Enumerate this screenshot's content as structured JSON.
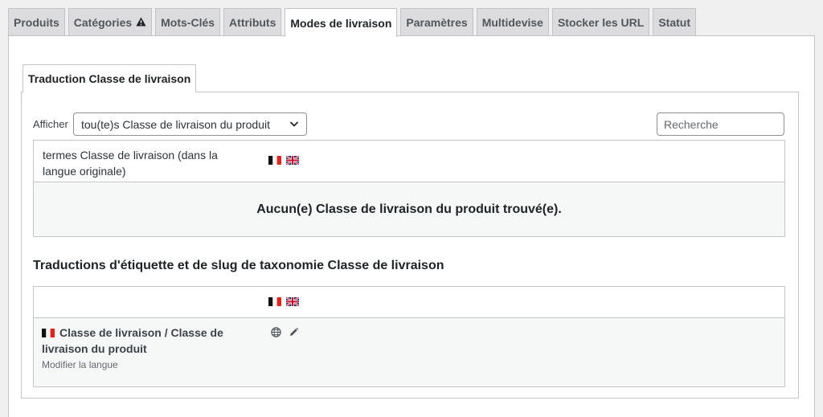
{
  "tabs": [
    {
      "label": "Produits",
      "active": false
    },
    {
      "label": "Catégories",
      "active": false,
      "warning": true
    },
    {
      "label": "Mots-Clés",
      "active": false
    },
    {
      "label": "Attributs",
      "active": false
    },
    {
      "label": "Modes de livraison",
      "active": true
    },
    {
      "label": "Paramètres",
      "active": false
    },
    {
      "label": "Multidevise",
      "active": false
    },
    {
      "label": "Stocker les URL",
      "active": false
    },
    {
      "label": "Statut",
      "active": false
    }
  ],
  "subtab": {
    "label": "Traduction Classe de livraison"
  },
  "filter": {
    "label": "Afficher",
    "selected": "tou(te)s Classe de livraison du produit",
    "search_placeholder": "Recherche"
  },
  "terms_table": {
    "column_header": "termes Classe de livraison (dans la langue originale)",
    "empty_message": "Aucun(e) Classe de livraison du produit trouvé(e)."
  },
  "section_title": "Traductions d'étiquette et de slug de taxonomie Classe de livraison",
  "taxonomy_table": {
    "row_title": "Classe de livraison / Classe de livraison du produit",
    "row_link": "Modifier la langue"
  },
  "icons": [
    "warning-icon",
    "chevron-down-icon",
    "flag-fr-icon",
    "flag-uk-icon",
    "globe-icon",
    "pencil-icon"
  ],
  "colors": {
    "active_tab": "#ffffff",
    "inactive_tab": "#dcdcde",
    "border": "#c3c4c7",
    "row_bg": "#f6f7f7"
  }
}
